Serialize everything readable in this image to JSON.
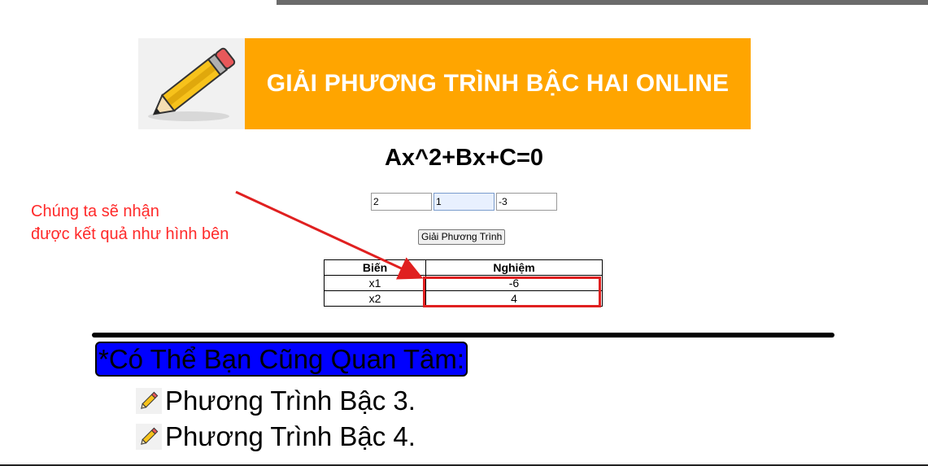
{
  "banner": {
    "title": "GIẢI PHƯƠNG TRÌNH BẬC HAI ONLINE",
    "logo": "pencil-icon"
  },
  "equation": "Ax^2+Bx+C=0",
  "inputs": {
    "a": "2",
    "b": "1",
    "c": "-3"
  },
  "solve_button": "Giải Phương Trình",
  "result_table": {
    "headers": [
      "Biến",
      "Nghiệm"
    ],
    "rows": [
      {
        "var": "x1",
        "value": "-6"
      },
      {
        "var": "x2",
        "value": "4"
      }
    ]
  },
  "annotation": {
    "line1": "Chúng ta sẽ nhận",
    "line2": "được kết quả như hình bên"
  },
  "suggestions": {
    "heading": "*Có Thể Bạn Cũng Quan Tâm:",
    "items": [
      {
        "label": "Phương Trình Bậc 3.",
        "icon": "pencil-icon"
      },
      {
        "label": "Phương Trình Bậc 4.",
        "icon": "pencil-icon"
      }
    ]
  },
  "colors": {
    "banner": "#ffa500",
    "annotation": "#ff2a2a",
    "heading_bg": "#0000ff"
  }
}
